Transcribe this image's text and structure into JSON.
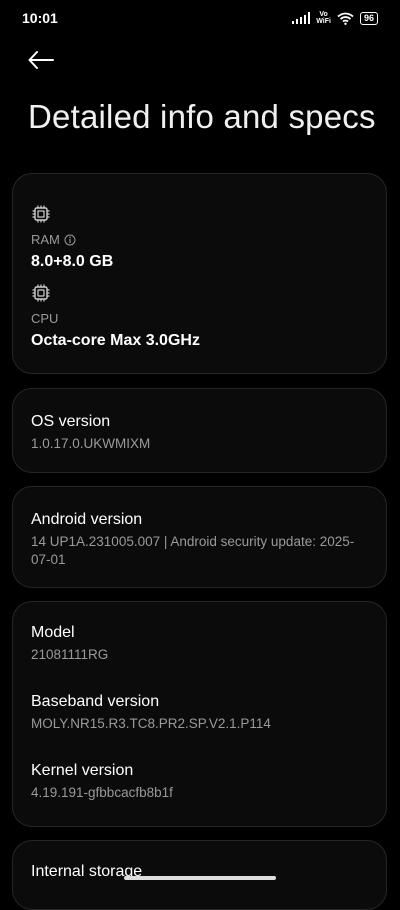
{
  "status": {
    "time": "10:01",
    "vowifi_top": "Vo",
    "vowifi_bottom": "WiFi",
    "battery": "96"
  },
  "page": {
    "title": "Detailed info and specs"
  },
  "hardware": {
    "ram_label": "RAM",
    "ram_value": "8.0+8.0 GB",
    "cpu_label": "CPU",
    "cpu_value": "Octa-core Max 3.0GHz"
  },
  "os": {
    "title": "OS version",
    "value": "1.0.17.0.UKWMIXM"
  },
  "android": {
    "title": "Android version",
    "value": "14 UP1A.231005.007 | Android security update: 2025-07-01"
  },
  "device": {
    "model_title": "Model",
    "model_value": "21081111RG",
    "baseband_title": "Baseband version",
    "baseband_value": "MOLY.NR15.R3.TC8.PR2.SP.V2.1.P114",
    "kernel_title": "Kernel version",
    "kernel_value": "4.19.191-gfbbcacfb8b1f"
  },
  "storage": {
    "title": "Internal storage"
  },
  "icons": {
    "back": "arrow-left-icon",
    "ram": "memory-chip-icon",
    "cpu": "cpu-chip-icon",
    "info": "info-icon"
  }
}
